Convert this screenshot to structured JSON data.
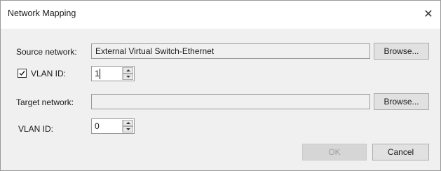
{
  "dialog": {
    "title": "Network Mapping",
    "close_glyph": "✕"
  },
  "source": {
    "label": "Source network:",
    "value": "External Virtual Switch-Ethernet",
    "browse_label": "Browse..."
  },
  "source_vlan": {
    "checkbox_checked": true,
    "label": "VLAN ID:",
    "value": "1"
  },
  "target": {
    "label": "Target network:",
    "value": "",
    "browse_label": "Browse..."
  },
  "target_vlan": {
    "label": "VLAN ID:",
    "value": "0"
  },
  "footer": {
    "ok_label": "OK",
    "cancel_label": "Cancel"
  },
  "icons": {
    "close": "close-icon",
    "check": "checkmark-icon",
    "spin_up": "chevron-up-icon",
    "spin_down": "chevron-down-icon"
  }
}
